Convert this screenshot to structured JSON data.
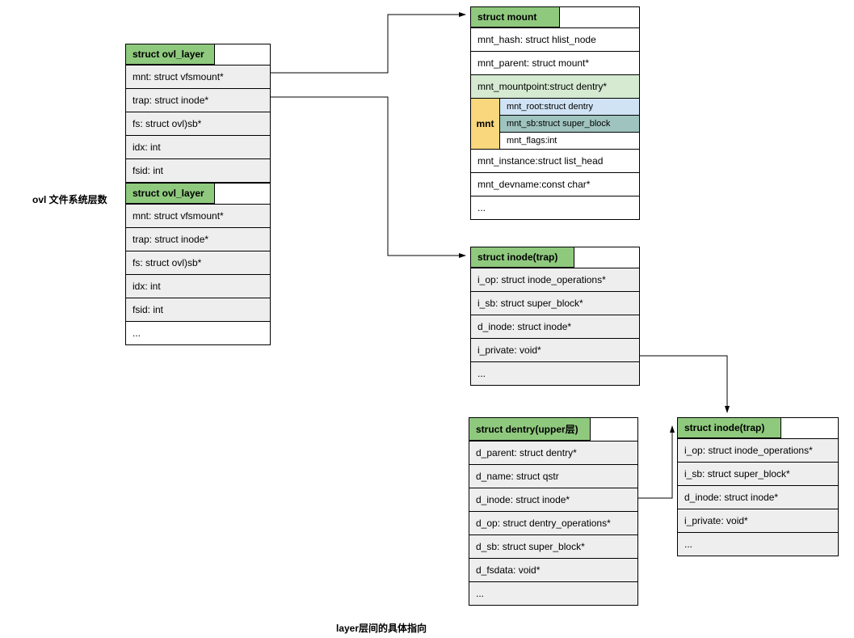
{
  "labels": {
    "left_annotation": "ovl 文件系统层数",
    "bottom_caption": "layer层间的具体指向"
  },
  "boxes": {
    "ovl_layer_a": {
      "title": "struct ovl_layer",
      "fields": [
        "mnt: struct vfsmount*",
        "trap: struct inode*",
        "fs: struct ovl)sb*",
        "idx: int",
        "fsid: int"
      ]
    },
    "ovl_layer_b": {
      "title": "struct ovl_layer",
      "fields": [
        "mnt: struct vfsmount*",
        "trap: struct inode*",
        "fs: struct ovl)sb*",
        "idx: int",
        "fsid: int",
        "..."
      ]
    },
    "mount": {
      "title": "struct mount",
      "fields_top": [
        "mnt_hash: struct hlist_node",
        "mnt_parent: struct mount*"
      ],
      "field_green": "mnt_mountpoint:struct dentry*",
      "nested_label": "mnt",
      "nested": [
        "mnt_root:struct dentry",
        "mnt_sb:struct super_block",
        "mnt_flags:int"
      ],
      "fields_bottom": [
        "mnt_instance:struct list_head",
        "mnt_devname:const char*",
        "..."
      ]
    },
    "inode_trap_a": {
      "title": "struct inode(trap)",
      "fields": [
        "i_op: struct inode_operations*",
        "i_sb: struct super_block*",
        "d_inode: struct inode*",
        "i_private: void*",
        "..."
      ]
    },
    "dentry_upper": {
      "title": "struct dentry(upper层)",
      "fields": [
        "d_parent: struct dentry*",
        "d_name: struct qstr",
        "d_inode: struct inode*",
        "d_op: struct dentry_operations*",
        "d_sb: struct super_block*",
        "d_fsdata: void*",
        "..."
      ]
    },
    "inode_trap_b": {
      "title": "struct inode(trap)",
      "fields": [
        "i_op: struct inode_operations*",
        "i_sb: struct super_block*",
        "d_inode: struct inode*",
        "i_private: void*",
        "..."
      ]
    }
  }
}
